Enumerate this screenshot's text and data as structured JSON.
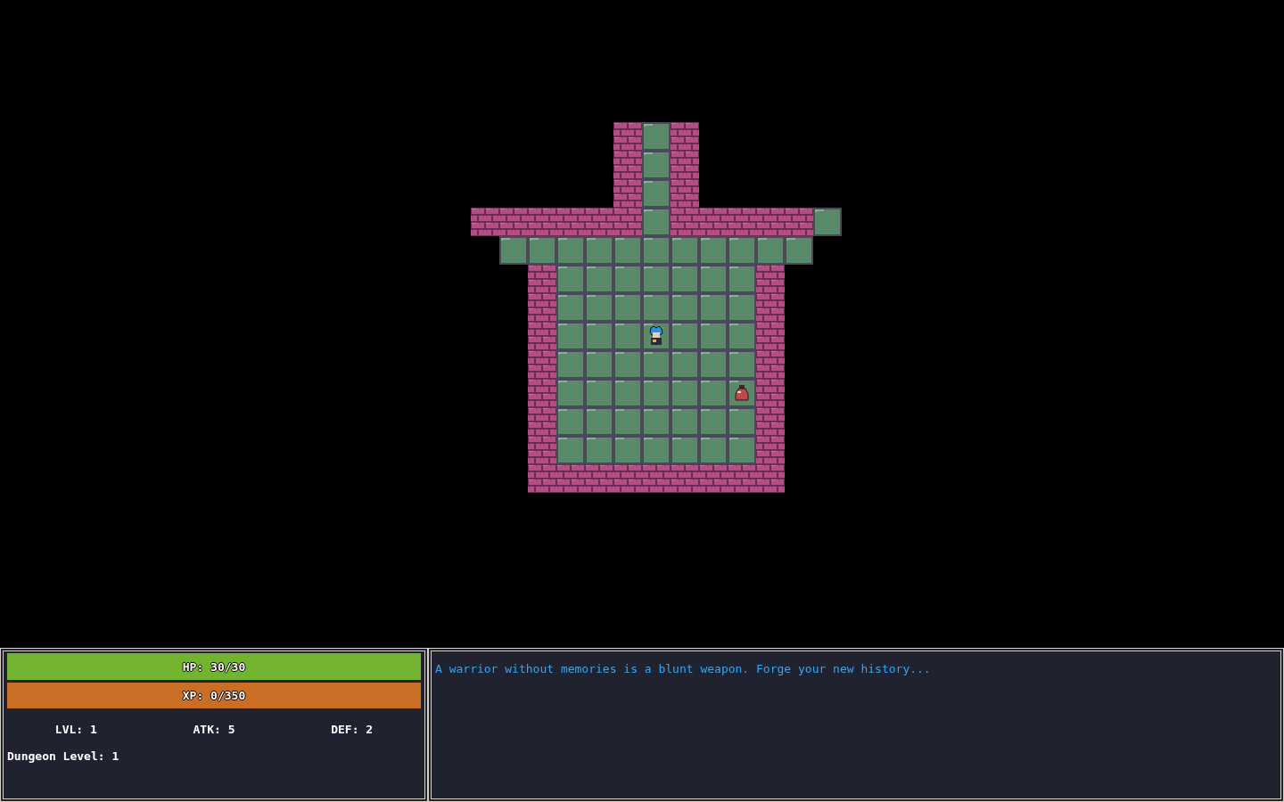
{
  "player_stats": {
    "hp_bar": {
      "label": "HP: 30/30",
      "level": 1
    },
    "xp_bar": {
      "label": "XP: 0/350",
      "level": 0
    },
    "stats": [
      "LVL: 1",
      "ATK: 5",
      "DEF: 2"
    ],
    "dungeon_level": "Dungeon Level: 1"
  },
  "message_log": [
    "A warrior without memories is a blunt weapon. Forge your new history..."
  ]
}
